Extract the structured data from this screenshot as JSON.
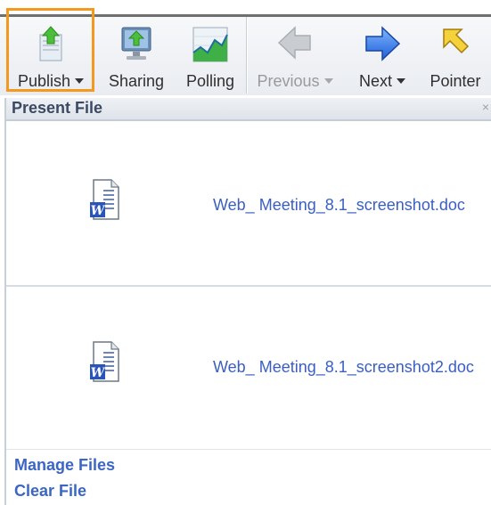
{
  "toolbar": {
    "items": [
      {
        "label": "Publish",
        "has_dropdown": true,
        "enabled": true,
        "icon": "publish-icon"
      },
      {
        "label": "Sharing",
        "has_dropdown": false,
        "enabled": true,
        "icon": "sharing-icon"
      },
      {
        "label": "Polling",
        "has_dropdown": false,
        "enabled": true,
        "icon": "polling-icon"
      },
      {
        "label": "Previous",
        "has_dropdown": true,
        "enabled": false,
        "icon": "previous-arrow-icon"
      },
      {
        "label": "Next",
        "has_dropdown": true,
        "enabled": true,
        "icon": "next-arrow-icon"
      },
      {
        "label": "Pointer",
        "has_dropdown": false,
        "enabled": true,
        "icon": "pointer-icon"
      }
    ]
  },
  "panel": {
    "title": "Present File",
    "close_glyph": "×"
  },
  "files": [
    {
      "name": "Web_ Meeting_8.1_screenshot.doc",
      "icon": "word-document-icon"
    },
    {
      "name": "Web_ Meeting_8.1_screenshot2.doc",
      "icon": "word-document-icon"
    }
  ],
  "links": {
    "manage_files": "Manage Files",
    "clear_file": "Clear File"
  },
  "colors": {
    "highlight": "#f39a1e",
    "link": "#3b66c4",
    "header_text": "#3b4a63"
  }
}
